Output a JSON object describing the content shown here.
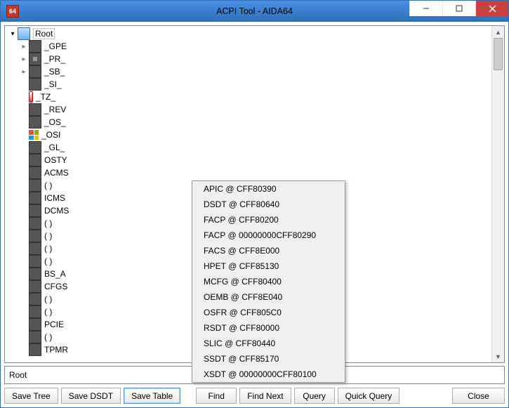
{
  "window": {
    "title": "ACPI Tool - AIDA64",
    "app_icon_text": "64"
  },
  "tree": {
    "root_label": "Root",
    "children": [
      {
        "label": "_GPE",
        "icon": "block",
        "twisty": "closed"
      },
      {
        "label": "_PR_",
        "icon": "chip",
        "twisty": "closed"
      },
      {
        "label": "_SB_",
        "icon": "block",
        "twisty": "closed"
      },
      {
        "label": "_SI_",
        "icon": "block",
        "twisty": "none"
      },
      {
        "label": "_TZ_",
        "icon": "therm",
        "twisty": "none"
      },
      {
        "label": "_REV",
        "icon": "block",
        "twisty": "none"
      },
      {
        "label": "_OS_",
        "icon": "block",
        "twisty": "none"
      },
      {
        "label": "_OSI",
        "icon": "win",
        "twisty": "none"
      },
      {
        "label": "_GL_",
        "icon": "block",
        "twisty": "none"
      },
      {
        "label": "OSTY",
        "icon": "block",
        "twisty": "none"
      },
      {
        "label": "ACMS",
        "icon": "block",
        "twisty": "none"
      },
      {
        "label": "( )",
        "icon": "block",
        "twisty": "none"
      },
      {
        "label": "ICMS",
        "icon": "block",
        "twisty": "none"
      },
      {
        "label": "DCMS",
        "icon": "block",
        "twisty": "none"
      },
      {
        "label": "( )",
        "icon": "block",
        "twisty": "none"
      },
      {
        "label": "( )",
        "icon": "block",
        "twisty": "none"
      },
      {
        "label": "( )",
        "icon": "block",
        "twisty": "none"
      },
      {
        "label": "( )",
        "icon": "block",
        "twisty": "none"
      },
      {
        "label": "BS_A",
        "icon": "block",
        "twisty": "none"
      },
      {
        "label": "CFGS",
        "icon": "block",
        "twisty": "none"
      },
      {
        "label": "( )",
        "icon": "block",
        "twisty": "none"
      },
      {
        "label": "( )",
        "icon": "block",
        "twisty": "none"
      },
      {
        "label": "PCIE",
        "icon": "block",
        "twisty": "none"
      },
      {
        "label": "( )",
        "icon": "block",
        "twisty": "none"
      },
      {
        "label": "TPMR",
        "icon": "block",
        "twisty": "none"
      }
    ]
  },
  "status": {
    "text": "Root"
  },
  "buttons": {
    "save_tree": "Save Tree",
    "save_dsdt": "Save DSDT",
    "save_table": "Save Table",
    "find": "Find",
    "find_next": "Find Next",
    "query": "Query",
    "quick_query": "Quick Query",
    "close": "Close"
  },
  "popup": [
    "APIC @ CFF80390",
    "DSDT @ CFF80640",
    "FACP @ CFF80200",
    "FACP @ 00000000CFF80290",
    "FACS @ CFF8E000",
    "HPET @ CFF85130",
    "MCFG @ CFF80400",
    "OEMB @ CFF8E040",
    "OSFR @ CFF805C0",
    "RSDT @ CFF80000",
    "SLIC @ CFF80440",
    "SSDT @ CFF85170",
    "XSDT @ 00000000CFF80100"
  ]
}
